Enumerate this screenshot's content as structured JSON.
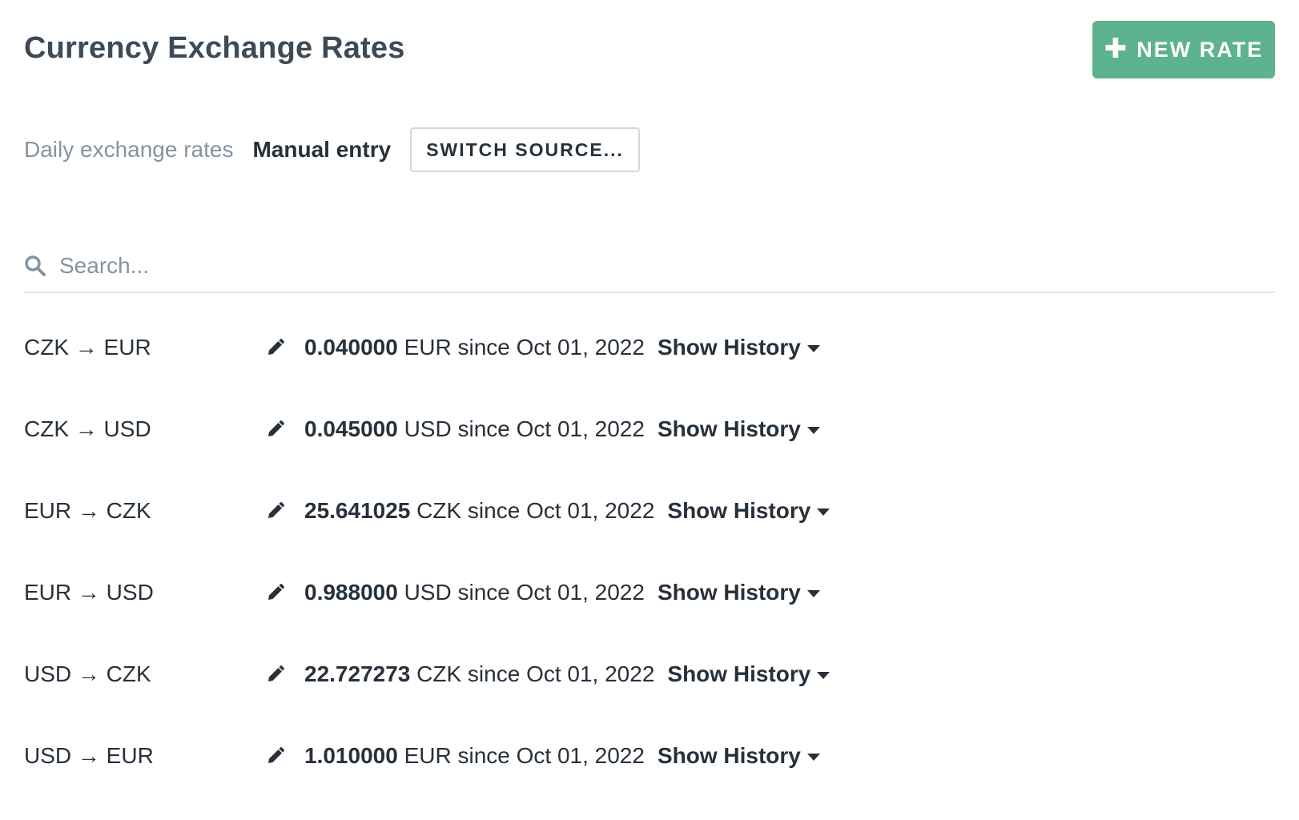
{
  "header": {
    "title": "Currency Exchange Rates",
    "new_rate_label": "NEW RATE",
    "new_rate_icon": "plus-icon",
    "accent_color": "#5db38f"
  },
  "source": {
    "label": "Daily exchange rates",
    "value": "Manual entry",
    "switch_label": "SWITCH SOURCE..."
  },
  "search": {
    "placeholder": "Search...",
    "value": "",
    "icon": "search-icon"
  },
  "rates": [
    {
      "pair": "CZK → EUR",
      "value": "0.040000",
      "suffix": "EUR since Oct 01, 2022",
      "history_label": "Show History"
    },
    {
      "pair": "CZK → USD",
      "value": "0.045000",
      "suffix": "USD since Oct 01, 2022",
      "history_label": "Show History"
    },
    {
      "pair": "EUR → CZK",
      "value": "25.641025",
      "suffix": "CZK since Oct 01, 2022",
      "history_label": "Show History"
    },
    {
      "pair": "EUR → USD",
      "value": "0.988000",
      "suffix": "USD since Oct 01, 2022",
      "history_label": "Show History"
    },
    {
      "pair": "USD → CZK",
      "value": "22.727273",
      "suffix": "CZK since Oct 01, 2022",
      "history_label": "Show History"
    },
    {
      "pair": "USD → EUR",
      "value": "1.010000",
      "suffix": "EUR since Oct 01, 2022",
      "history_label": "Show History"
    }
  ]
}
